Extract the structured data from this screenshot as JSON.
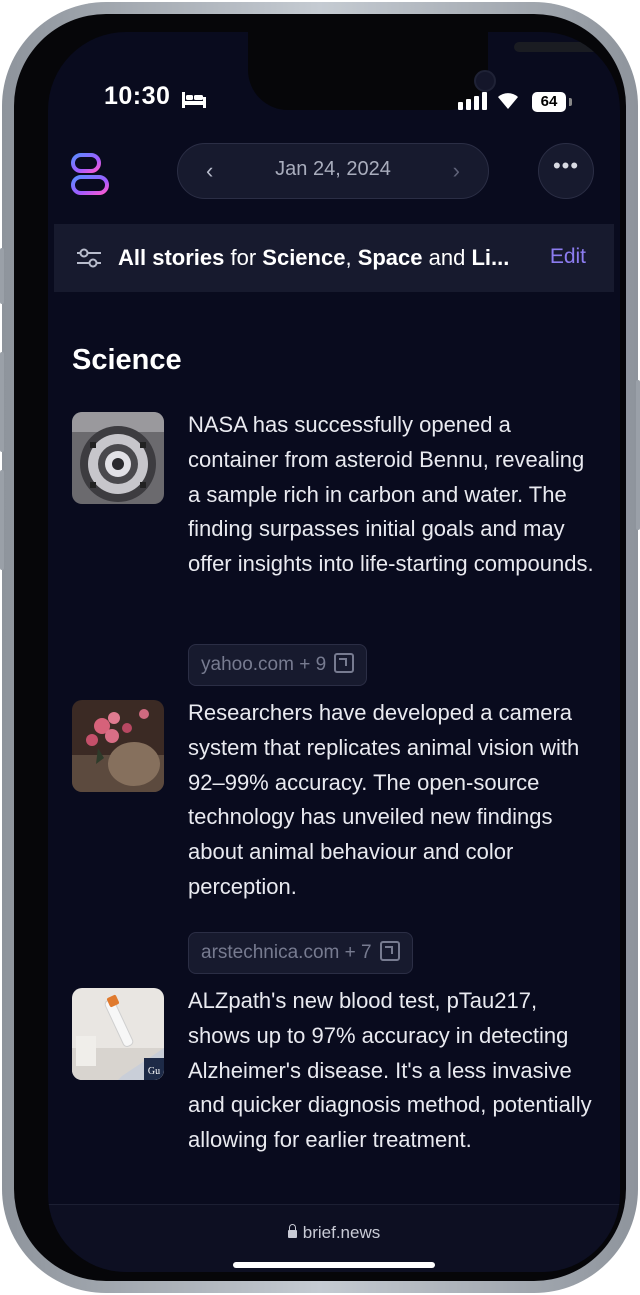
{
  "status_bar": {
    "time": "10:30",
    "battery": "64"
  },
  "header": {
    "date": "Jan 24, 2024",
    "prev_icon": "chevron-left-icon",
    "next_icon": "chevron-right-icon",
    "more_label": "•••"
  },
  "filter": {
    "lead": "All stories",
    "for": " for ",
    "topic1": "Science",
    "sep": ", ",
    "topic2": "Space",
    "and": " and ",
    "topic3": "Li...",
    "edit": "Edit"
  },
  "section": {
    "title": "Science"
  },
  "stories": [
    {
      "text": "NASA has successfully opened a container from asteroid Bennu, revealing a sample rich in carbon and water. The finding surpasses initial goals and may offer insights into life-starting compounds.",
      "source": "yahoo.com + 9"
    },
    {
      "text": "Researchers have developed a camera system that replicates animal vision with 92–99% accuracy. The open-source technology has unveiled new findings about animal behaviour and color perception.",
      "source": "arstechnica.com + 7"
    },
    {
      "text": "ALZpath's new blood test, pTau217, shows up to 97% accuracy in detecting Alzheimer's disease. It's a less invasive and quicker diagnosis method, potentially allowing for earlier treatment.",
      "source": ""
    }
  ],
  "bottom": {
    "url": "brief.news"
  },
  "colors": {
    "background": "#090b1e",
    "accent": "#8c7cf0",
    "card": "#171a2e"
  }
}
